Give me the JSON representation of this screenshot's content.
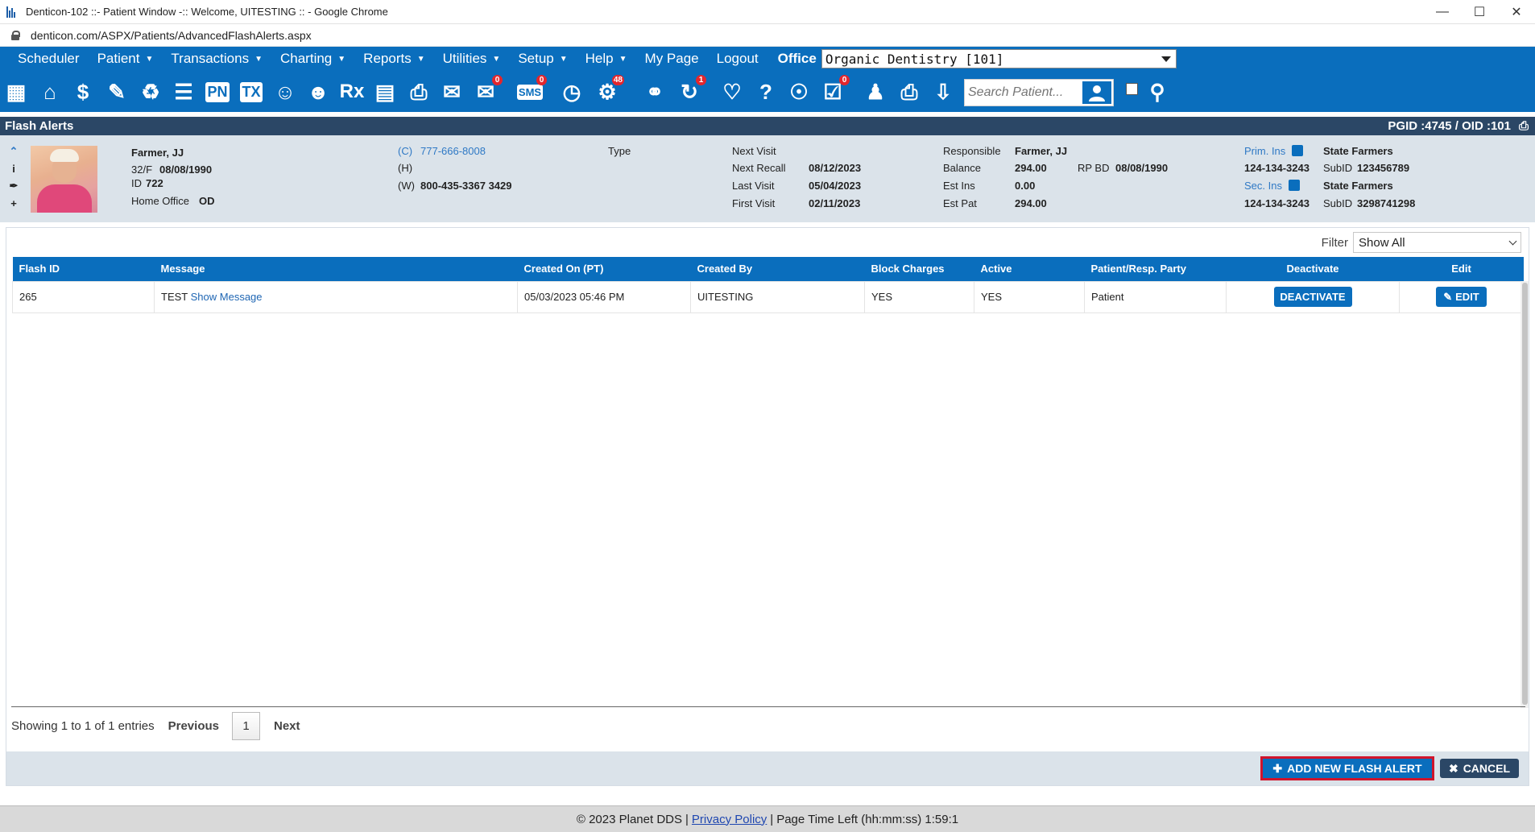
{
  "window": {
    "title": "Denticon-102 ::- Patient Window -:: Welcome, UITESTING :: - Google Chrome",
    "url": "denticon.com/ASPX/Patients/AdvancedFlashAlerts.aspx"
  },
  "menu": {
    "items": [
      "Scheduler",
      "Patient",
      "Transactions",
      "Charting",
      "Reports",
      "Utilities",
      "Setup",
      "Help",
      "My Page",
      "Logout"
    ],
    "office_label": "Office",
    "office_value": "Organic Dentistry [101]"
  },
  "toolbar": {
    "search_placeholder": "Search Patient...",
    "badges": {
      "messages": "0",
      "sms": "0",
      "web": "48",
      "recall": "1",
      "forms": "0"
    },
    "icon_labels": {
      "pn": "PN",
      "tx": "TX",
      "sms": "SMS",
      "rx": "Rx"
    }
  },
  "section": {
    "title": "Flash Alerts",
    "ids": "PGID :4745  /  OID :101"
  },
  "patient": {
    "name": "Farmer, JJ",
    "age_sex": "32/F",
    "dob": "08/08/1990",
    "id_label": "ID",
    "id": "722",
    "home_office_label": "Home Office",
    "home_office": "OD",
    "phone_c_label": "(C)",
    "phone_c": "777-666-8008",
    "phone_h_label": "(H)",
    "phone_w_label": "(W)",
    "phone_w": "800-435-3367 3429",
    "type_label": "Type",
    "next_visit_label": "Next Visit",
    "next_recall_label": "Next Recall",
    "next_recall": "08/12/2023",
    "last_visit_label": "Last Visit",
    "last_visit": "05/04/2023",
    "first_visit_label": "First Visit",
    "first_visit": "02/11/2023",
    "responsible_label": "Responsible",
    "responsible": "Farmer, JJ",
    "balance_label": "Balance",
    "balance": "294.00",
    "rp_bd_label": "RP BD",
    "rp_bd": "08/08/1990",
    "est_ins_label": "Est Ins",
    "est_ins": "0.00",
    "est_pat_label": "Est Pat",
    "est_pat": "294.00",
    "prim_ins_label": "Prim. Ins",
    "prim_carrier": "State Farmers",
    "prim_phone": "124-134-3243",
    "prim_subid_label": "SubID",
    "prim_subid": "123456789",
    "sec_ins_label": "Sec. Ins",
    "sec_carrier": "State Farmers",
    "sec_phone": "124-134-3243",
    "sec_subid_label": "SubID",
    "sec_subid": "3298741298"
  },
  "filter": {
    "label": "Filter",
    "value": "Show All"
  },
  "table": {
    "headers": [
      "Flash ID",
      "Message",
      "Created On (PT)",
      "Created By",
      "Block Charges",
      "Active",
      "Patient/Resp. Party",
      "Deactivate",
      "Edit"
    ],
    "rows": [
      {
        "flash_id": "265",
        "message": "TEST",
        "show_message": "Show Message",
        "created_on": "05/03/2023 05:46 PM",
        "created_by": "UITESTING",
        "block_charges": "YES",
        "active": "YES",
        "party": "Patient",
        "deactivate": "DEACTIVATE",
        "edit": "EDIT"
      }
    ]
  },
  "pager": {
    "info": "Showing 1 to 1 of 1 entries",
    "previous": "Previous",
    "page": "1",
    "next": "Next"
  },
  "actions": {
    "add": "ADD NEW FLASH ALERT",
    "cancel": "CANCEL"
  },
  "footer": {
    "copyright": "© 2023 Planet DDS",
    "sep": "|",
    "privacy": "Privacy Policy",
    "time_left": "Page Time Left (hh:mm:ss) 1:59:1"
  }
}
